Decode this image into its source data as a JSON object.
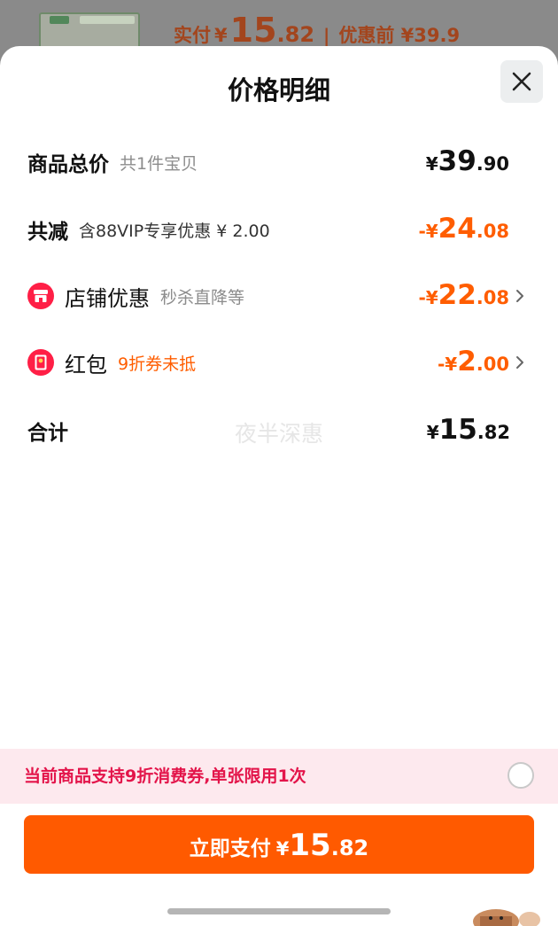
{
  "background": {
    "pay_label": "实付",
    "pay_yen": "¥",
    "pay_int": "15",
    "pay_dec": ".82",
    "separator": "|",
    "original_label": "优惠前 ¥39.9"
  },
  "sheet": {
    "title": "价格明细",
    "close_icon": "close-icon"
  },
  "rows": {
    "total": {
      "label": "商品总价",
      "sub": "共1件宝贝",
      "prefix": "¥",
      "int": "39",
      "dec": ".90"
    },
    "discount": {
      "label": "共减",
      "sub": "含88VIP专享优惠 ¥ 2.00",
      "prefix": "-¥",
      "int": "24",
      "dec": ".08"
    },
    "store": {
      "label": "店铺优惠",
      "sub": "秒杀直降等",
      "prefix": "-¥",
      "int": "22",
      "dec": ".08",
      "icon": "store-icon"
    },
    "redpacket": {
      "label": "红包",
      "sub": "9折券未抵",
      "prefix": "-¥",
      "int": "2",
      "dec": ".00",
      "icon": "red-packet-icon"
    },
    "sum": {
      "label": "合计",
      "prefix": "¥",
      "int": "15",
      "dec": ".82"
    }
  },
  "watermark": "夜半深惠",
  "notice": {
    "text": "当前商品支持9折消费券,单张限用1次"
  },
  "pay_button": {
    "label": "立即支付",
    "yen": "¥",
    "int": "15",
    "dec": ".82"
  },
  "colors": {
    "accent_orange": "#ff5a00",
    "notice_red": "#e3144a",
    "icon_red": "#ff1f46"
  }
}
